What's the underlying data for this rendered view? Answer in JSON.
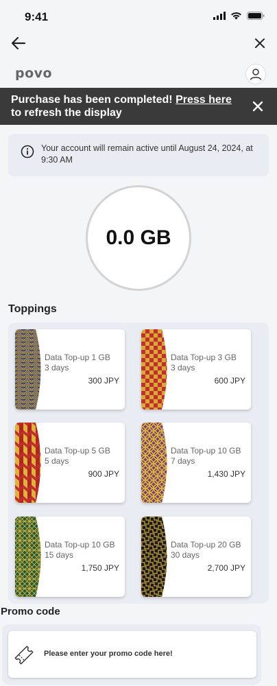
{
  "status_bar": {
    "time": "9:41"
  },
  "brand": {
    "logo_text": "povo"
  },
  "toast": {
    "message": "Purchase has been completed! ",
    "link_label": "Press here",
    "suffix": "to refresh the display"
  },
  "account_notice": {
    "text": "Your account will remain active until August 24, 2024, at 9:30 AM"
  },
  "data_balance": {
    "value": "0.0 GB"
  },
  "toppings": {
    "title": "Toppings",
    "items": [
      {
        "name": "Data Top-up 1 GB",
        "days": "3 days",
        "price": "300 JPY",
        "pattern": "seigaiha-waves"
      },
      {
        "name": "Data Top-up 3 GB",
        "days": "3 days",
        "price": "600 JPY",
        "pattern": "ichimatsu-checker"
      },
      {
        "name": "Data Top-up 5 GB",
        "days": "5 days",
        "price": "900 JPY",
        "pattern": "yagasuri-arrows"
      },
      {
        "name": "Data Top-up 10 GB",
        "days": "7 days",
        "price": "1,430 JPY",
        "pattern": "shippo-circles"
      },
      {
        "name": "Data Top-up 10 GB",
        "days": "15 days",
        "price": "1,750 JPY",
        "pattern": "asanoha-hemp"
      },
      {
        "name": "Data Top-up 20 GB",
        "days": "30 days",
        "price": "2,700 JPY",
        "pattern": "sayagata-key"
      }
    ]
  },
  "promo": {
    "title": "Promo code",
    "placeholder": "Please enter your promo code here!"
  },
  "colors": {
    "toast_bg": "#3a3a3a",
    "panel_bg": "#e9ecf2",
    "page_bg": "#f4f5f7"
  }
}
